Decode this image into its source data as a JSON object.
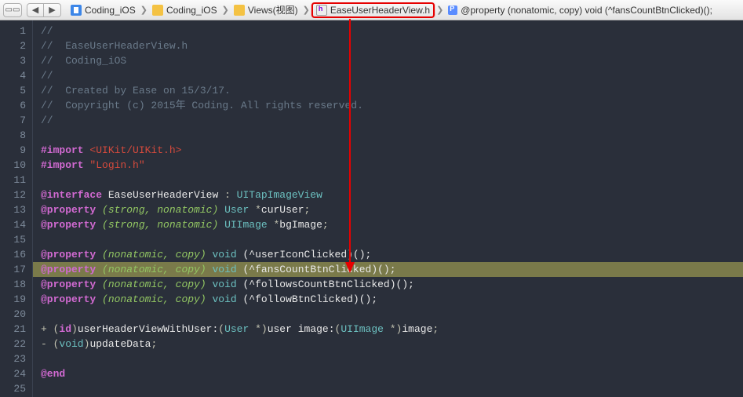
{
  "breadcrumbs": {
    "items": [
      {
        "icon": "proj",
        "label": "Coding_iOS"
      },
      {
        "icon": "folder",
        "label": "Coding_iOS"
      },
      {
        "icon": "folder",
        "label": "Views(视图)"
      },
      {
        "icon": "hfile",
        "label": "EaseUserHeaderView.h",
        "highlight": true
      },
      {
        "icon": "def",
        "label": "@property (nonatomic, copy) void (^fansCountBtnClicked)();"
      }
    ]
  },
  "code": {
    "lines": [
      {
        "n": 1,
        "type": "comment",
        "raw": "//"
      },
      {
        "n": 2,
        "type": "comment",
        "raw": "//  EaseUserHeaderView.h"
      },
      {
        "n": 3,
        "type": "comment",
        "raw": "//  Coding_iOS"
      },
      {
        "n": 4,
        "type": "comment",
        "raw": "//"
      },
      {
        "n": 5,
        "type": "comment",
        "raw": "//  Created by Ease on 15/3/17."
      },
      {
        "n": 6,
        "type": "comment",
        "raw": "//  Copyright (c) 2015年 Coding. All rights reserved."
      },
      {
        "n": 7,
        "type": "comment",
        "raw": "//"
      },
      {
        "n": 8,
        "type": "blank"
      },
      {
        "n": 9,
        "type": "import",
        "directive": "#import",
        "value": "<UIKit/UIKit.h>"
      },
      {
        "n": 10,
        "type": "import",
        "directive": "#import",
        "value": "\"Login.h\""
      },
      {
        "n": 11,
        "type": "blank"
      },
      {
        "n": 12,
        "type": "interface",
        "kw": "@interface",
        "cls": "EaseUserHeaderView",
        "sep": " : ",
        "base": "UITapImageView"
      },
      {
        "n": 13,
        "type": "prop-typed",
        "kw": "@property",
        "attrs": "(strong, nonatomic)",
        "ptype": "User",
        "star": " *",
        "name": "curUser",
        "tail": ";"
      },
      {
        "n": 14,
        "type": "prop-typed",
        "kw": "@property",
        "attrs": "(strong, nonatomic)",
        "ptype": "UIImage",
        "star": " *",
        "name": "bgImage",
        "tail": ";"
      },
      {
        "n": 15,
        "type": "blank"
      },
      {
        "n": 16,
        "type": "prop-block",
        "kw": "@property",
        "attrs": "(nonatomic, copy)",
        "ret": "void",
        "blk": "(^userIconClicked)();"
      },
      {
        "n": 17,
        "type": "prop-block",
        "kw": "@property",
        "attrs": "(nonatomic, copy)",
        "ret": "void",
        "blk": "(^fansCountBtnClicked)();",
        "current": true
      },
      {
        "n": 18,
        "type": "prop-block",
        "kw": "@property",
        "attrs": "(nonatomic, copy)",
        "ret": "void",
        "blk": "(^followsCountBtnClicked)();"
      },
      {
        "n": 19,
        "type": "prop-block",
        "kw": "@property",
        "attrs": "(nonatomic, copy)",
        "ret": "void",
        "blk": "(^followBtnClicked)();"
      },
      {
        "n": 20,
        "type": "blank"
      },
      {
        "n": 21,
        "type": "method",
        "sign": "+ ",
        "ret": "id",
        "name": "userHeaderViewWithUser:",
        "p1type": "User",
        "p1star": " *",
        "p1name": "user",
        "seg2": " image:",
        "p2type": "UIImage",
        "p2star": " *",
        "p2name": "image",
        "tail": ";"
      },
      {
        "n": 22,
        "type": "method-void",
        "sign": "- ",
        "ret": "void",
        "name": "updateData",
        "tail": ";"
      },
      {
        "n": 23,
        "type": "blank"
      },
      {
        "n": 24,
        "type": "end",
        "kw": "@end"
      },
      {
        "n": 25,
        "type": "blank"
      }
    ]
  }
}
